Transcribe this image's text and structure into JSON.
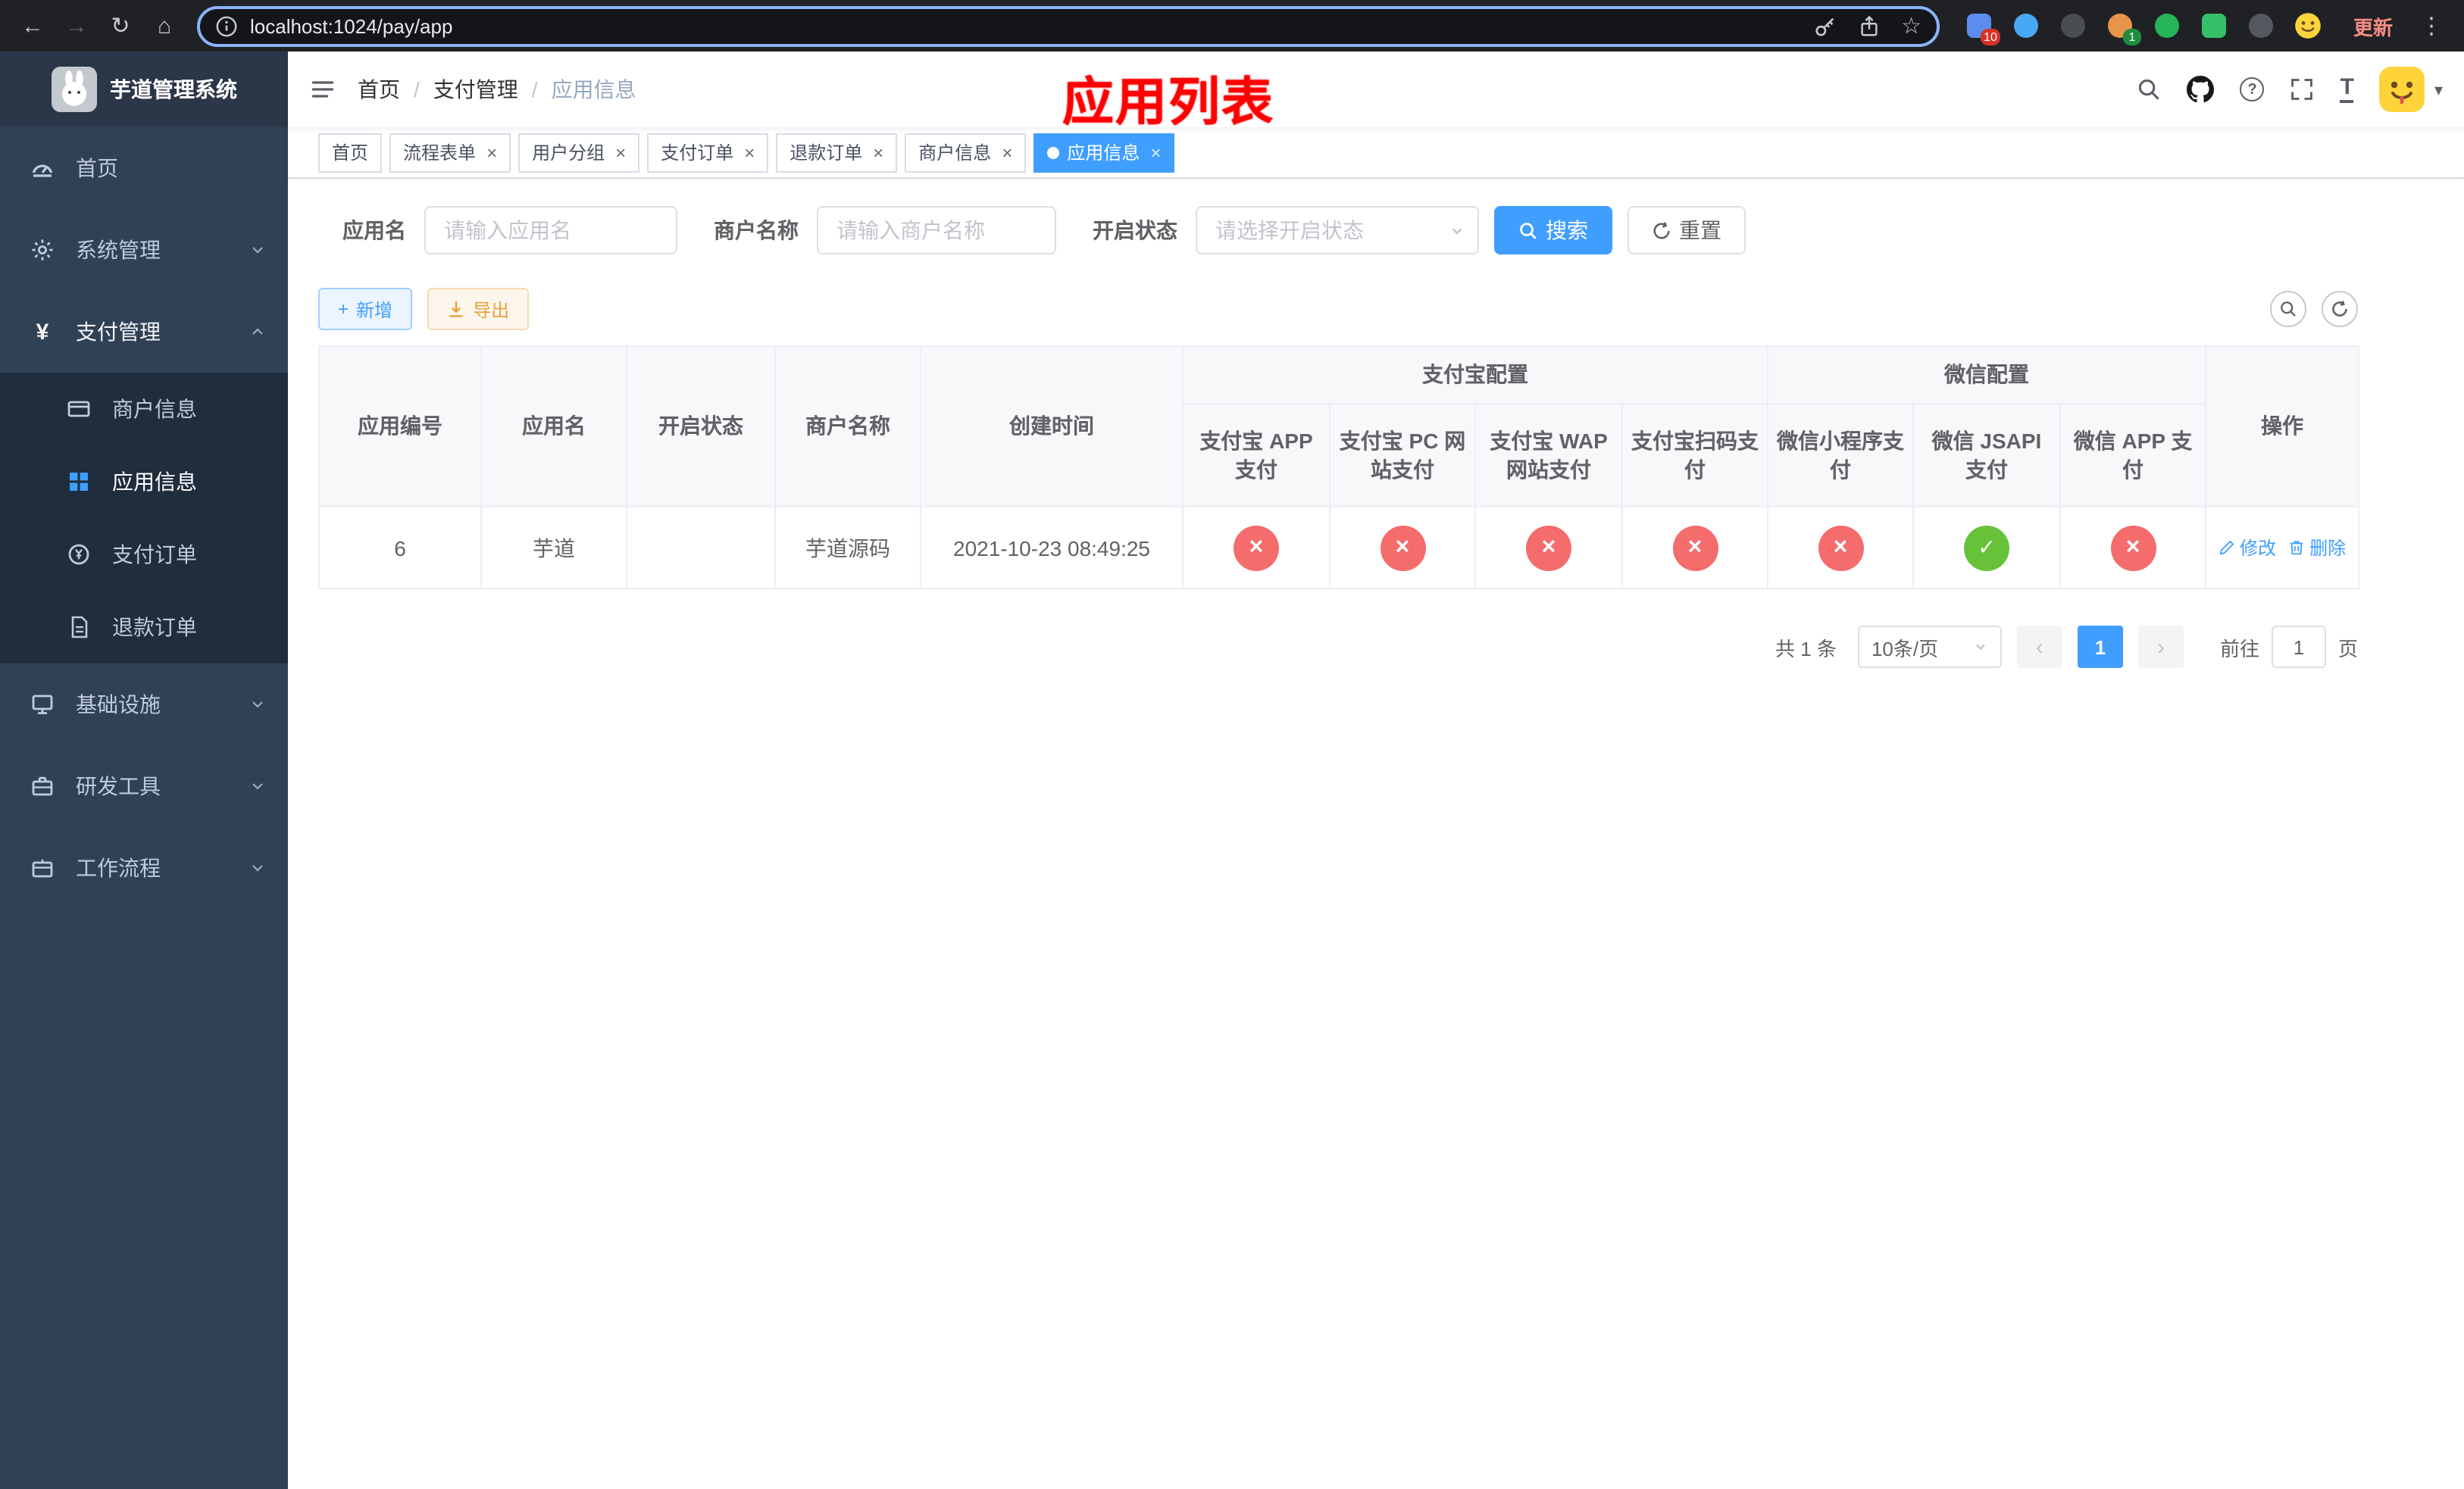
{
  "accent_color": "#409eff",
  "browser": {
    "url": "localhost:1024/pay/app",
    "update_label": "更新",
    "extension_badge_count": "10",
    "profile_badge_count": "1"
  },
  "icons": {
    "back": "←",
    "forward": "→",
    "reload": "↻",
    "home": "⌂",
    "star": "☆",
    "menu_dots": "⋮",
    "caret_down": "▾",
    "close": "×",
    "check": "✓",
    "cross": "×",
    "yen": "¥",
    "question": "?",
    "font_size": "T",
    "prev": "‹",
    "next": "›",
    "plus": "+"
  },
  "sidebar": {
    "title": "芋道管理系统",
    "menu_home": "首页",
    "menu_system": "系统管理",
    "menu_payment": "支付管理",
    "menu_merchant": "商户信息",
    "menu_app_info": "应用信息",
    "menu_pay_order": "支付订单",
    "menu_refund_order": "退款订单",
    "menu_infra": "基础设施",
    "menu_devtools": "研发工具",
    "menu_workflow": "工作流程"
  },
  "navbar": {
    "breadcrumb_home": "首页",
    "breadcrumb_payment": "支付管理",
    "breadcrumb_current": "应用信息",
    "annotation": "应用列表"
  },
  "tabs": [
    {
      "label": "首页",
      "closable": false,
      "active": false
    },
    {
      "label": "流程表单",
      "closable": true,
      "active": false
    },
    {
      "label": "用户分组",
      "closable": true,
      "active": false
    },
    {
      "label": "支付订单",
      "closable": true,
      "active": false
    },
    {
      "label": "退款订单",
      "closable": true,
      "active": false
    },
    {
      "label": "商户信息",
      "closable": true,
      "active": false
    },
    {
      "label": "应用信息",
      "closable": true,
      "active": true
    }
  ],
  "filters": {
    "app_name_label": "应用名",
    "app_name_placeholder": "请输入应用名",
    "merchant_label": "商户名称",
    "merchant_placeholder": "请输入商户名称",
    "status_label": "开启状态",
    "status_placeholder": "请选择开启状态",
    "search_label": "搜索",
    "reset_label": "重置"
  },
  "toolbar": {
    "add_label": "新增",
    "export_label": "导出"
  },
  "table": {
    "headers": {
      "app_id": "应用编号",
      "app_name": "应用名",
      "status": "开启状态",
      "merchant_name": "商户名称",
      "create_time": "创建时间",
      "alipay_group": "支付宝配置",
      "wechat_group": "微信配置",
      "alipay_app": "支付宝 APP 支付",
      "alipay_pc": "支付宝 PC 网站支付",
      "alipay_wap": "支付宝 WAP 网站支付",
      "alipay_qr": "支付宝扫码支付",
      "wechat_mini": "微信小程序支付",
      "wechat_jsapi": "微信 JSAPI 支付",
      "wechat_app": "微信 APP 支付",
      "actions": "操作"
    },
    "row": {
      "app_id": "6",
      "app_name": "芋道",
      "status": "on",
      "merchant_name": "芋道源码",
      "create_time": "2021-10-23 08:49:25",
      "alipay_app": "disabled",
      "alipay_pc": "disabled",
      "alipay_wap": "disabled",
      "alipay_qr": "disabled",
      "wechat_mini": "disabled",
      "wechat_jsapi": "enabled",
      "wechat_app": "disabled",
      "edit_label": "修改",
      "delete_label": "删除"
    },
    "status_colors": {
      "enabled": "#67c23a",
      "disabled": "#f56c6c"
    }
  },
  "pagination": {
    "total_label": "共 1 条",
    "page_size_label": "10条/页",
    "current_page": "1",
    "goto_label": "前往",
    "goto_value": "1",
    "unit_label": "页"
  }
}
